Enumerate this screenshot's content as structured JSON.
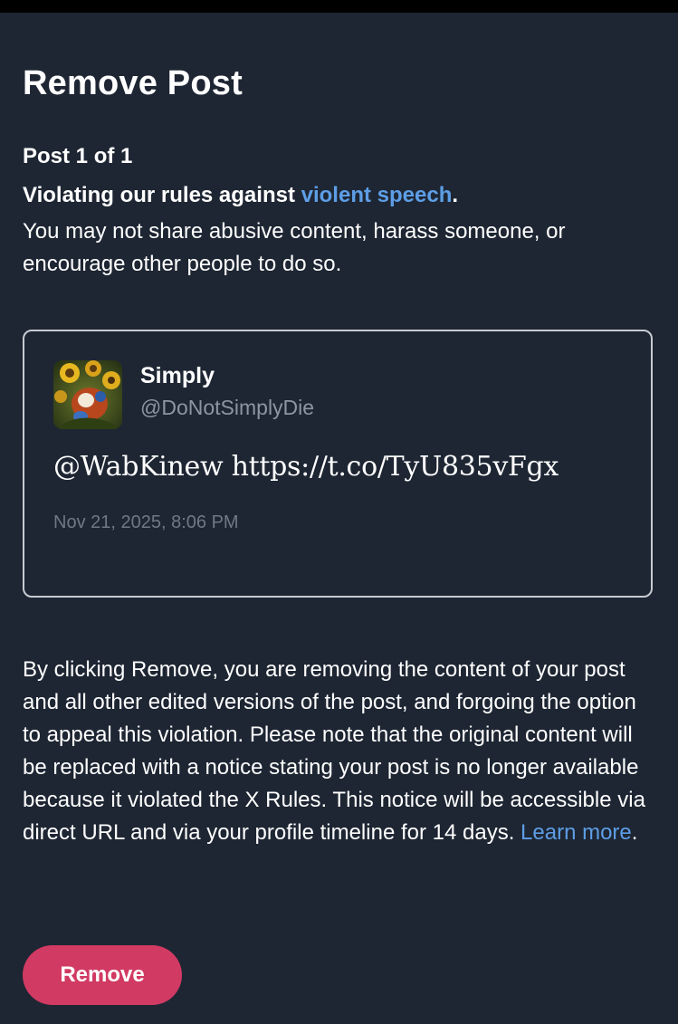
{
  "dialog": {
    "title": "Remove Post",
    "post_count": "Post 1 of 1",
    "violation_prefix": "Violating our rules against ",
    "violation_link": "violent speech",
    "violation_suffix": ".",
    "rule_description": "You may not share abusive content, harass someone, or encourage other people to do so."
  },
  "post": {
    "author_name": "Simply",
    "author_handle": "@DoNotSimplyDie",
    "text": "@WabKinew https://t.co/TyU835vFgx",
    "timestamp": "Nov 21, 2025, 8:06 PM",
    "avatar_icon": "sunflower-avatar-icon"
  },
  "disclaimer": {
    "text": "By clicking Remove, you are removing the content of your post and all other edited versions of the post, and forgoing the option to appeal this violation. Please note that the original content will be replaced with a notice stating your post is no longer available because it violated the X Rules. This notice will be accessible via direct URL and via your profile timeline for 14 days. ",
    "link": "Learn more",
    "suffix": "."
  },
  "actions": {
    "remove_label": "Remove"
  },
  "colors": {
    "background": "#1e2633",
    "link": "#5d9ee6",
    "remove_button": "#d13a63",
    "card_border": "#c7cbd2",
    "muted_text": "#8c95a1"
  }
}
